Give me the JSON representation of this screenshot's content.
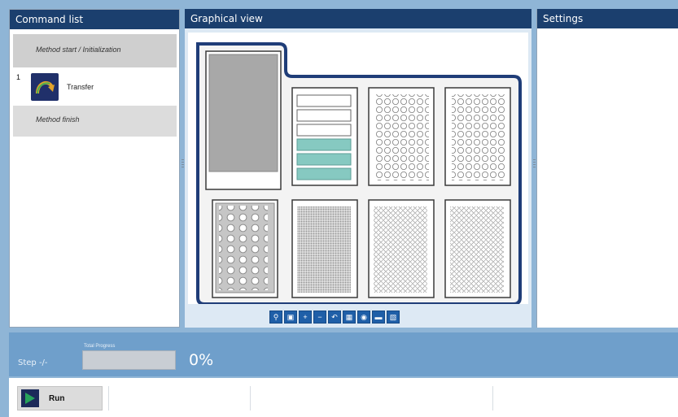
{
  "panels": {
    "command_list": "Command list",
    "graphical_view": "Graphical view",
    "settings": "Settings"
  },
  "commands": {
    "start": "Method start / Initialization",
    "step_number": "1",
    "transfer": "Transfer",
    "finish": "Method finish"
  },
  "bottom": {
    "step": "Step -/-",
    "progress_label": "Total Progress",
    "progress_fraction": 0,
    "percent": "0%",
    "run": "Run"
  },
  "colors": {
    "header": "#1b3f6e",
    "panel_bg": "#8fb5d6",
    "deck_outline": "#1f3d78",
    "reservoir_teal": "#86c9c1",
    "run_icon": "#1c2a5a",
    "run_arrow": "#27a35b"
  },
  "icons": {
    "transfer": "arrow-curve-icon",
    "run": "play-icon"
  },
  "toolbar_icons": [
    "zoom-search-icon",
    "fit-icon",
    "zoom-in-icon",
    "zoom-out-icon",
    "undo-icon",
    "grid-icon",
    "layer-icon",
    "minimize-icon",
    "trash-icon"
  ]
}
